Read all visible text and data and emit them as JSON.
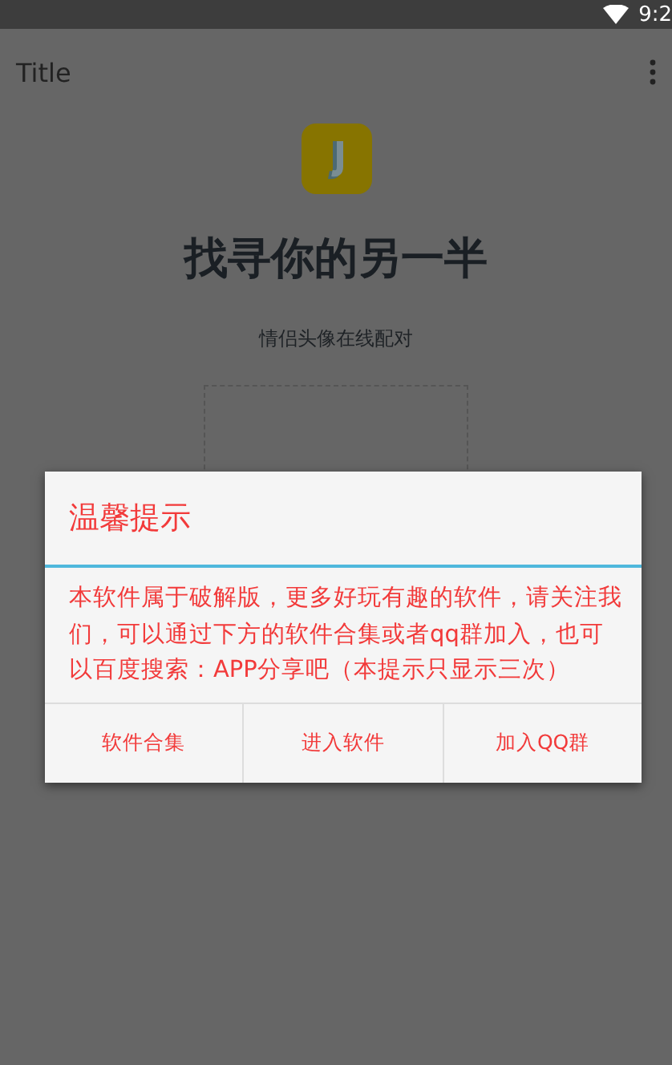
{
  "status_bar": {
    "time": "9:2"
  },
  "app_bar": {
    "title": "Title"
  },
  "main": {
    "headline": "找寻你的另一半",
    "subtitle": "情侣头像在线配对"
  },
  "dialog": {
    "title": "温馨提示",
    "message": "本软件属于破解版，更多好玩有趣的软件，请关注我们，可以通过下方的软件合集或者qq群加入，也可以百度搜索：APP分享吧（本提示只显示三次）",
    "buttons": [
      "软件合集",
      "进入软件",
      "加入QQ群"
    ]
  }
}
